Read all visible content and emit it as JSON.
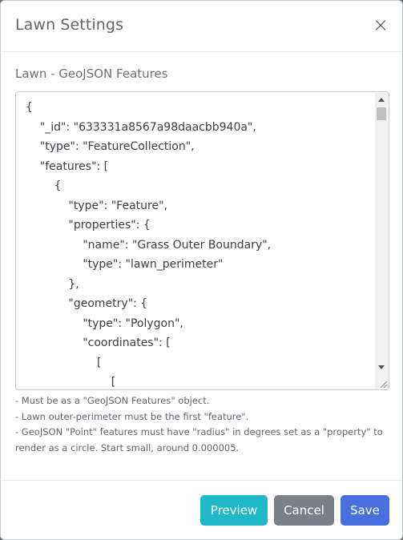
{
  "modal": {
    "title": "Lawn Settings",
    "close_symbol": "×"
  },
  "field": {
    "label": "Lawn - GeoJSON Features",
    "value_lines": [
      "{",
      "    \"_id\": \"633331a8567a98daacbb940a\",",
      "    \"type\": \"FeatureCollection\",",
      "    \"features\": [",
      "        {",
      "            \"type\": \"Feature\",",
      "            \"properties\": {",
      "                \"name\": \"Grass Outer Boundary\",",
      "                \"type\": \"lawn_perimeter\"",
      "            },",
      "            \"geometry\": {",
      "                \"type\": \"Polygon\",",
      "                \"coordinates\": [",
      "                    [",
      "                        ["
    ]
  },
  "help": [
    "- Must be as a \"GeoJSON Features\" object.",
    "- Lawn outer-perimeter must be the first \"feature\".",
    "- GeoJSON \"Point\" features must have \"radius\" in degrees set as a \"property\" to render as a circle. Start small, around 0.000005."
  ],
  "buttons": {
    "preview": "Preview",
    "cancel": "Cancel",
    "save": "Save"
  },
  "colors": {
    "preview": "#1fb8c9",
    "cancel": "#7a808a",
    "save": "#4a6fe0"
  }
}
